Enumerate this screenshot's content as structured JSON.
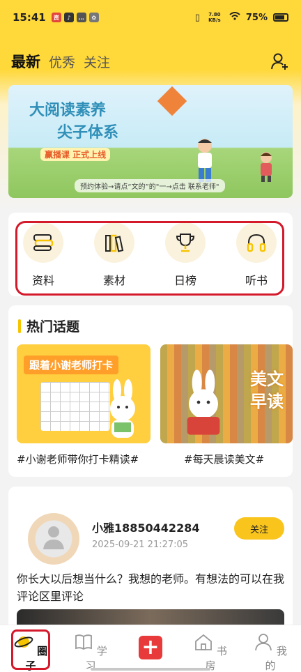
{
  "status_bar": {
    "time": "15:41",
    "network_speed": "7.80 KB/s",
    "battery": "75%"
  },
  "header": {
    "tabs": [
      {
        "label": "最新",
        "active": true
      },
      {
        "label": "优秀",
        "active": false
      },
      {
        "label": "关注",
        "active": false
      }
    ],
    "add_user_icon": "add-user-icon"
  },
  "banner": {
    "line1": "大阅读素养",
    "line2": "尖子体系",
    "tag": "赢播课 正式上线",
    "footer": "预约体验→请点“文的”的\"一→点击 联系老师\""
  },
  "quick_nav": [
    {
      "label": "资料",
      "icon": "stack-icon"
    },
    {
      "label": "素材",
      "icon": "books-icon"
    },
    {
      "label": "日榜",
      "icon": "trophy-icon"
    },
    {
      "label": "听书",
      "icon": "headphones-icon"
    }
  ],
  "topics": {
    "title": "热门话题",
    "items": [
      {
        "label": "#小谢老师带你打卡精读#",
        "image_caption": "跟着小谢老师打卡"
      },
      {
        "label": "#每天晨读美文#",
        "image_caption": "美文早读"
      }
    ]
  },
  "post": {
    "username": "小雅18850442284",
    "time": "2025-09-21 21:27:05",
    "follow_label": "关注",
    "content": "你长大以后想当什么？我想的老师。有想法的可以在我评论区里评论"
  },
  "bottom_nav": [
    {
      "label": "圈子",
      "icon": "planet-icon",
      "active": true
    },
    {
      "label": "学习",
      "icon": "book-icon",
      "active": false
    },
    {
      "label": "",
      "icon": "plus-icon",
      "active": false
    },
    {
      "label": "书房",
      "icon": "house-icon",
      "active": false
    },
    {
      "label": "我的",
      "icon": "person-icon",
      "active": false
    }
  ],
  "colors": {
    "accent": "#ffd83a",
    "highlight_outline": "#d4192b",
    "follow_button": "#f9c51d",
    "plus_button": "#e83a3a"
  }
}
